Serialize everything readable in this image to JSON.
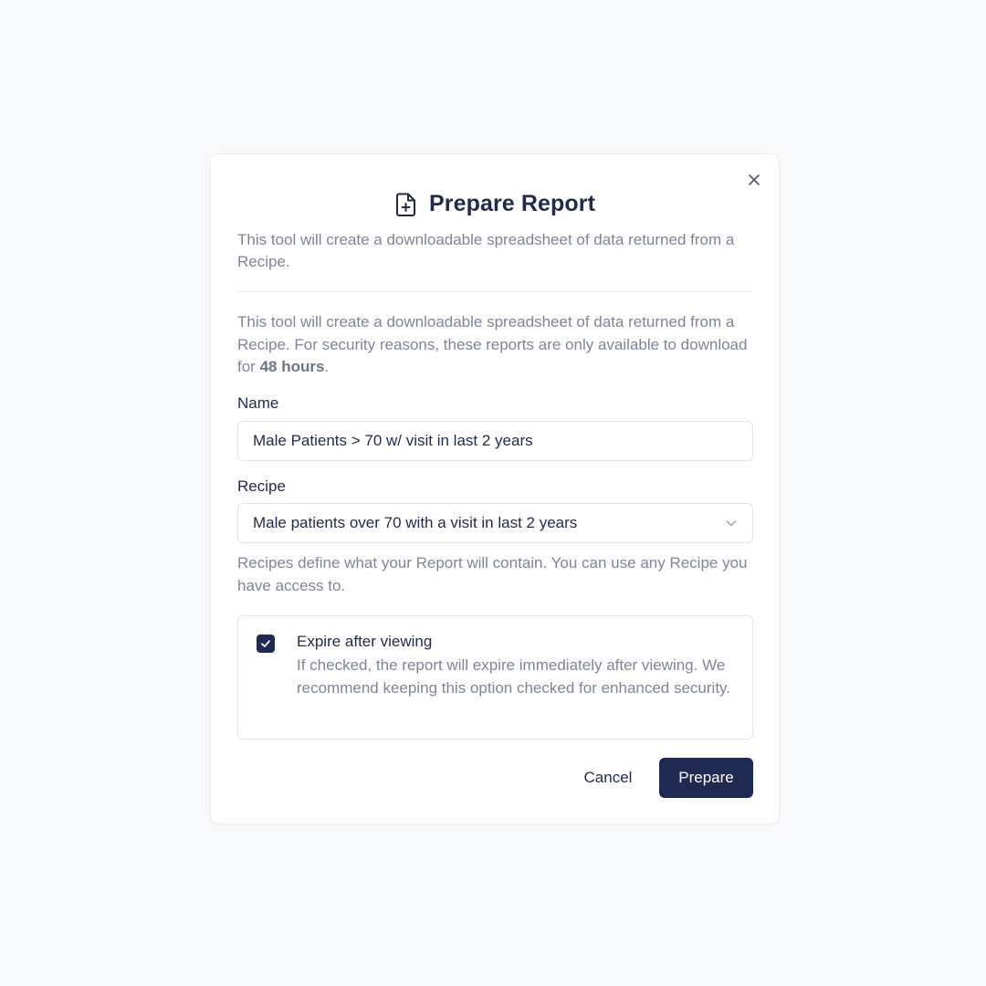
{
  "dialog": {
    "title": "Prepare Report",
    "title_icon": "file-plus-icon",
    "close_icon": "close-icon",
    "subtitle": "This tool will create a downloadable spreadsheet of data returned from a Recipe."
  },
  "info": {
    "text_before": "This tool will create a downloadable spreadsheet of data returned from a Recipe. For security reasons, these reports are only available to download for ",
    "highlight": "48 hours",
    "text_after": "."
  },
  "name_field": {
    "label": "Name",
    "value": "Male Patients > 70 w/ visit in last 2 years"
  },
  "recipe_field": {
    "label": "Recipe",
    "selected": "Male patients over 70 with a visit in last 2 years",
    "dropdown_icon": "chevron-down-icon",
    "help": "Recipes define what your Report will contain. You can use any Recipe you have access to."
  },
  "expire_option": {
    "checked": true,
    "title": "Expire after viewing",
    "description": "If checked, the report will expire immediately after viewing. We recommend keeping this option checked for enhanced security."
  },
  "actions": {
    "cancel_label": "Cancel",
    "prepare_label": "Prepare"
  },
  "colors": {
    "primary": "#1e2a52",
    "muted_text": "#7c8699",
    "background": "#f8f9fb"
  }
}
